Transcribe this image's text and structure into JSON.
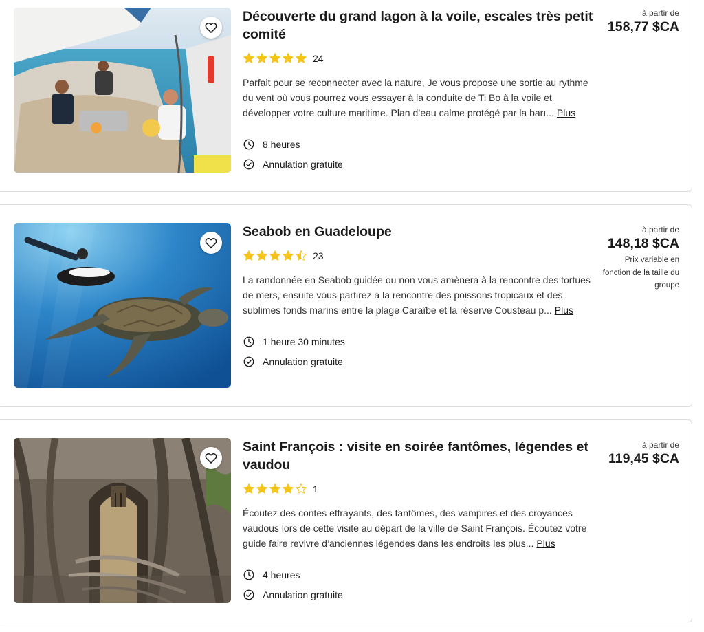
{
  "listings": [
    {
      "title": "Découverte du grand lagon à la voile, escales très petit comité",
      "rating_value": 5,
      "rating_count": "24",
      "description": "Parfait pour se reconnecter avec la nature, Je vous propose une sortie au rythme du vent où vous pourrez vous essayer à la conduite de Ti Bo à la voile et développer votre culture maritime. Plan d’eau calme protégé par la barı...",
      "more_label": "Plus",
      "duration": "8 heures",
      "cancellation": "Annulation gratuite",
      "price_from": "à partir de",
      "price": "158,77 $CA",
      "price_note": ""
    },
    {
      "title": "Seabob en Guadeloupe",
      "rating_value": 4.5,
      "rating_count": "23",
      "description": "La randonnée en Seabob guidée ou non vous amènera à la rencontre des tortues de mers, ensuite vous partirez à la rencontre des poissons tropicaux et des sublimes fonds marins entre la plage Caraïbe et la réserve Cousteau p...",
      "more_label": "Plus",
      "duration": "1 heure 30 minutes",
      "cancellation": "Annulation gratuite",
      "price_from": "à partir de",
      "price": "148,18 $CA",
      "price_note": "Prix variable en fonction de la taille du groupe"
    },
    {
      "title": "Saint François : visite en soirée fantômes, légendes et vaudou",
      "rating_value": 4,
      "rating_count": "1",
      "description": "Écoutez des contes effrayants, des fantômes, des vampires et des croyances vaudous lors de cette visite au départ de la ville de Saint François. Écoutez votre guide faire revivre d’anciennes légendes dans les endroits les plus...",
      "more_label": "Plus",
      "duration": "4 heures",
      "cancellation": "Annulation gratuite",
      "price_from": "à partir de",
      "price": "119,45 $CA",
      "price_note": ""
    }
  ],
  "icons": {
    "favorite": "heart-outline-icon",
    "duration": "clock-icon",
    "cancellation": "check-circle-icon",
    "star": "star-icon"
  },
  "colors": {
    "star": "#f5c51b",
    "star_empty_stroke": "#f5c51b",
    "border": "#dcdcdc",
    "text": "#1a1a1a"
  }
}
